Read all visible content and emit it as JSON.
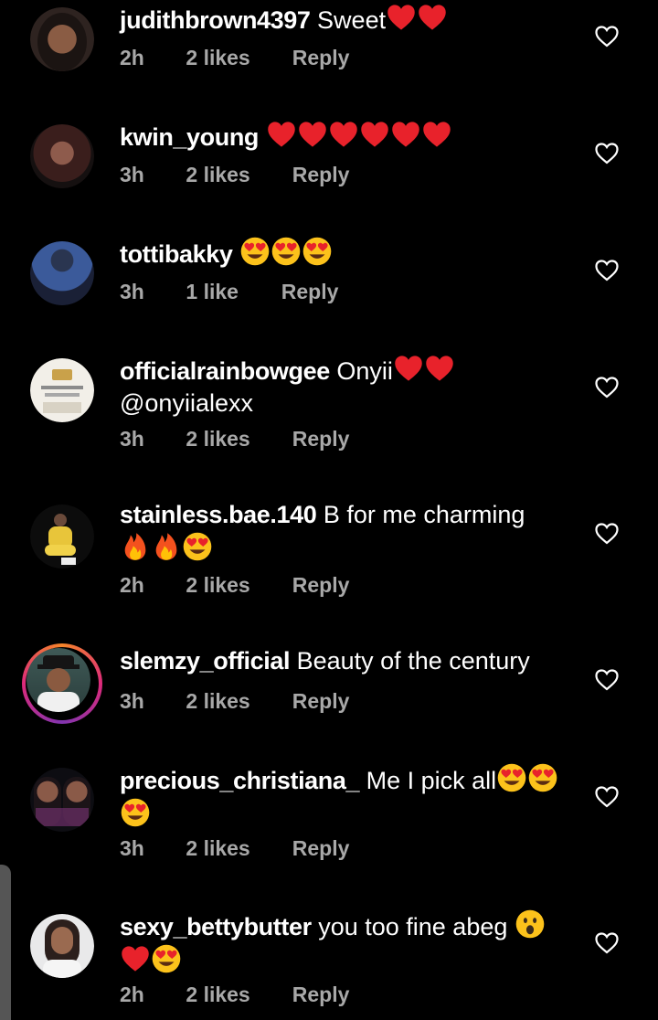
{
  "comments": [
    {
      "username": "judithbrown4397",
      "text": "Sweet",
      "emojis": [
        "heart",
        "heart"
      ],
      "emojis2": [],
      "time": "2h",
      "likes": "2 likes",
      "reply": "Reply"
    },
    {
      "username": "kwin_young",
      "text": "",
      "emojis": [
        "heart",
        "heart",
        "heart",
        "heart",
        "heart",
        "heart"
      ],
      "emojis2": [],
      "time": "3h",
      "likes": "2 likes",
      "reply": "Reply"
    },
    {
      "username": "tottibakky",
      "text": "",
      "emojis": [
        "heart-eyes",
        "heart-eyes",
        "heart-eyes"
      ],
      "emojis2": [],
      "time": "3h",
      "likes": "1 like",
      "reply": "Reply"
    },
    {
      "username": "officialrainbowgee",
      "text": "Onyii",
      "emojis": [
        "heart",
        "heart"
      ],
      "line2": "@onyiialexx",
      "emojis2": [],
      "time": "3h",
      "likes": "2 likes",
      "reply": "Reply"
    },
    {
      "username": "stainless.bae.140",
      "text": "B for me charming",
      "emojis": [],
      "emojis2": [
        "fire",
        "fire",
        "heart-eyes"
      ],
      "time": "2h",
      "likes": "2 likes",
      "reply": "Reply"
    },
    {
      "username": "slemzy_official",
      "text": "Beauty of the century",
      "emojis": [],
      "emojis2": [],
      "time": "3h",
      "likes": "2 likes",
      "reply": "Reply"
    },
    {
      "username": "precious_christiana_",
      "text": "Me I pick all",
      "emojis": [
        "heart-eyes",
        "heart-eyes"
      ],
      "emojis2": [
        "heart-eyes"
      ],
      "time": "3h",
      "likes": "2 likes",
      "reply": "Reply"
    },
    {
      "username": "sexy_bettybutter",
      "text": "you too fine abeg",
      "emojis": [
        "astonished"
      ],
      "emojis2": [
        "heart",
        "heart-eyes"
      ],
      "time": "2h",
      "likes": "2 likes",
      "reply": "Reply"
    }
  ],
  "colors": {
    "background": "#000000",
    "text": "#ffffff",
    "meta": "#a8a8a8",
    "heart": "#e8222b",
    "emoji_face": "#fcc21b",
    "story_ring": "#dd2a7b"
  }
}
